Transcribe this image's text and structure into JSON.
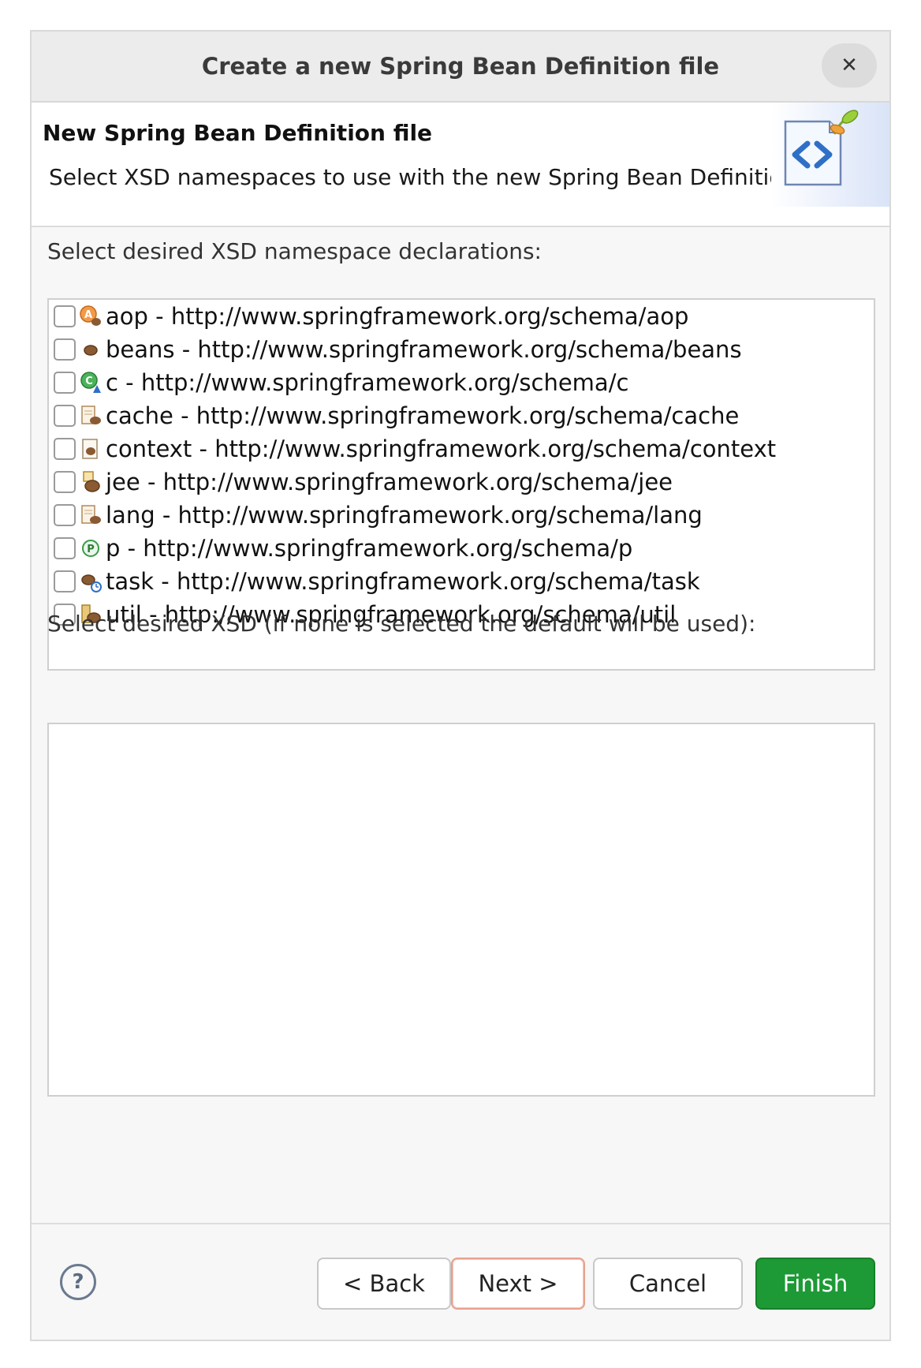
{
  "window": {
    "title": "Create a new Spring Bean Definition file",
    "close_label": "✕"
  },
  "header": {
    "title": "New Spring Bean Definition file",
    "description": "Select XSD namespaces to use with the new Spring Bean Definition"
  },
  "namespaces": {
    "label": "Select desired XSD namespace declarations:",
    "items": [
      {
        "label": "aop - http://www.springframework.org/schema/aop",
        "icon": "aop-icon",
        "checked": false
      },
      {
        "label": "beans - http://www.springframework.org/schema/beans",
        "icon": "beans-icon",
        "checked": false
      },
      {
        "label": "c - http://www.springframework.org/schema/c",
        "icon": "c-namespace-icon",
        "checked": false
      },
      {
        "label": "cache - http://www.springframework.org/schema/cache",
        "icon": "cache-icon",
        "checked": false
      },
      {
        "label": "context - http://www.springframework.org/schema/context",
        "icon": "context-icon",
        "checked": false
      },
      {
        "label": "jee - http://www.springframework.org/schema/jee",
        "icon": "jee-icon",
        "checked": false
      },
      {
        "label": "lang - http://www.springframework.org/schema/lang",
        "icon": "lang-icon",
        "checked": false
      },
      {
        "label": "p - http://www.springframework.org/schema/p",
        "icon": "p-namespace-icon",
        "checked": false
      },
      {
        "label": "task - http://www.springframework.org/schema/task",
        "icon": "task-icon",
        "checked": false
      },
      {
        "label": "util - http://www.springframework.org/schema/util",
        "icon": "util-icon",
        "checked": false
      }
    ]
  },
  "xsd": {
    "label": "Select desired XSD (if none is selected the default will be used):",
    "items": []
  },
  "buttons": {
    "help": "?",
    "back": "< Back",
    "next": "Next >",
    "cancel": "Cancel",
    "finish": "Finish"
  },
  "colors": {
    "finish_bg": "#1d9a35",
    "next_focus_border": "#e8a08e"
  }
}
